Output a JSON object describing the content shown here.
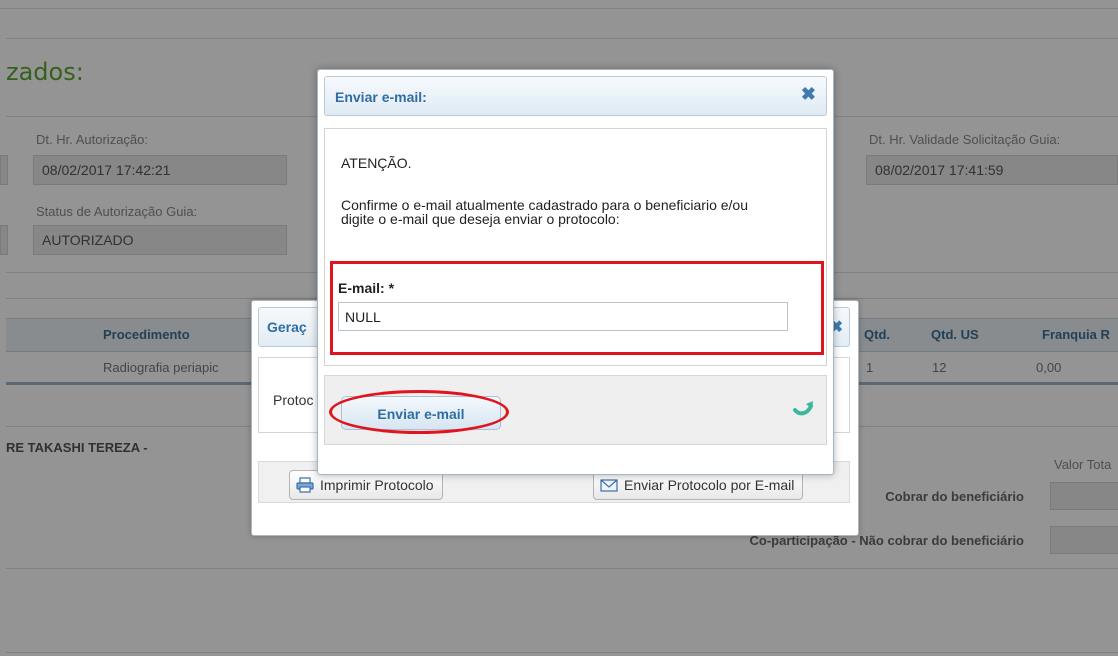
{
  "page": {
    "section_title": "zados:",
    "fields": {
      "autorizacao_label": "Dt. Hr. Autorização:",
      "autorizacao_value": "08/02/2017 17:42:21",
      "validade_label": "Dt. Hr. Validade Solicitação Guia:",
      "validade_value": "08/02/2017 17:41:59",
      "status_label": "Status de Autorização Guia:",
      "status_value": "AUTORIZADO"
    },
    "table": {
      "headers": [
        "Procedimento",
        "Qtd.",
        "Qtd. US",
        "Franquia R"
      ],
      "row": [
        "Radiografia periapic",
        "1",
        "12",
        "0,00"
      ]
    },
    "name": "RE TAKASHI TEREZA -",
    "summary": {
      "valor_total_label": "Valor Tota",
      "cobrar_label": "Cobrar do beneficiário",
      "nao_cobrar_label": "Co-participação - Não cobrar do beneficiário"
    }
  },
  "dialog_protocol": {
    "title": "Geraç",
    "body_text": "Protoc",
    "print_button": "Imprimir Protocolo",
    "email_button": "Enviar Protocolo por E-mail"
  },
  "dialog_email": {
    "title": "Enviar e-mail:",
    "close_symbol": "✖",
    "attention": "ATENÇÃO.",
    "message": "Confirme o e-mail atualmente cadastrado para o beneficiario e/ou digite o e-mail que deseja enviar o protocolo:",
    "email_label": "E-mail: *",
    "email_value": "NULL",
    "send_button": "Enviar e-mail"
  },
  "colors": {
    "highlight_red": "#e0141e",
    "title_blue": "#2f6ea5",
    "section_green": "#5aa832",
    "refresh_teal": "#3bb89b"
  }
}
